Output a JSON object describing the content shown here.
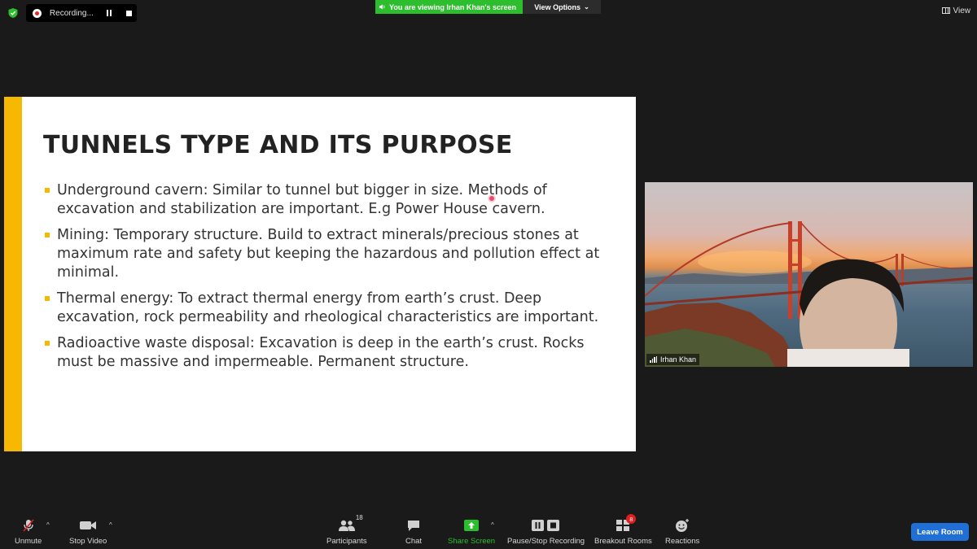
{
  "recording": {
    "label": "Recording..."
  },
  "banner": {
    "viewing_text": "You are viewing Irhan Khan's screen",
    "view_options": "View Options"
  },
  "view_button": {
    "label": "View"
  },
  "slide": {
    "title": "TUNNELS TYPE AND ITS PURPOSE",
    "bullets": [
      "Underground cavern: Similar to tunnel but bigger in size. Methods of excavation and stabilization are important. E.g Power House cavern.",
      "Mining: Temporary structure. Build to extract minerals/precious stones at maximum rate and safety but keeping the hazardous and pollution effect at minimal.",
      "Thermal energy: To extract thermal energy from earth’s crust. Deep excavation, rock permeability and rheological characteristics are important.",
      "Radioactive waste disposal: Excavation is deep in the earth’s crust. Rocks must be massive and impermeable. Permanent structure."
    ],
    "accent_color": "#f6b800"
  },
  "video": {
    "participant_name": "Irhan Khan"
  },
  "toolbar": {
    "unmute": "Unmute",
    "stop_video": "Stop Video",
    "participants": "Participants",
    "participants_count": "18",
    "chat": "Chat",
    "share_screen": "Share Screen",
    "pause_stop_recording": "Pause/Stop Recording",
    "breakout_rooms": "Breakout Rooms",
    "breakout_badge": "8",
    "reactions": "Reactions",
    "leave_room": "Leave Room"
  },
  "colors": {
    "share_green": "#2dbe2d",
    "leave_blue": "#1f6fd6",
    "badge_red": "#e02020"
  }
}
